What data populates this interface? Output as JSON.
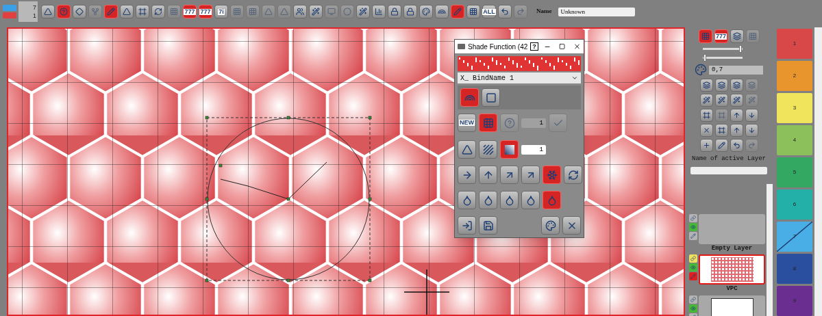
{
  "toolbar": {
    "counts": [
      "7",
      "1"
    ],
    "buttons": [
      {
        "kind": "shade",
        "selected": false,
        "disabled": false
      },
      {
        "kind": "help",
        "selected": true,
        "disabled": false
      },
      {
        "kind": "diamond",
        "selected": false,
        "disabled": false
      },
      {
        "kind": "fork",
        "selected": false,
        "disabled": true
      },
      {
        "kind": "pencil",
        "selected": true,
        "disabled": false
      },
      {
        "kind": "shade",
        "selected": false,
        "disabled": false
      },
      {
        "kind": "frame",
        "selected": false,
        "disabled": false
      },
      {
        "kind": "rotate",
        "selected": false,
        "disabled": false
      },
      {
        "kind": "grid",
        "selected": false,
        "disabled": true
      },
      {
        "kind": "text",
        "label": "777",
        "selected": true,
        "disabled": false
      },
      {
        "kind": "text",
        "label": "777",
        "selected": true,
        "disabled": false
      },
      {
        "kind": "text",
        "label": "7i",
        "selected": false,
        "disabled": false
      },
      {
        "kind": "grid",
        "selected": false,
        "disabled": true
      },
      {
        "kind": "grid",
        "selected": false,
        "disabled": true
      },
      {
        "kind": "shade",
        "selected": false,
        "disabled": true
      },
      {
        "kind": "shade",
        "selected": false,
        "disabled": true
      },
      {
        "kind": "people",
        "selected": false,
        "disabled": false
      },
      {
        "kind": "wand",
        "selected": false,
        "disabled": false
      },
      {
        "kind": "monitor",
        "selected": false,
        "disabled": true
      },
      {
        "kind": "circle",
        "selected": false,
        "disabled": true
      },
      {
        "kind": "wand",
        "selected": false,
        "disabled": false
      },
      {
        "kind": "chart",
        "selected": false,
        "disabled": false
      },
      {
        "kind": "lock",
        "selected": false,
        "disabled": false
      },
      {
        "kind": "lock",
        "selected": false,
        "disabled": false
      },
      {
        "kind": "palette",
        "selected": false,
        "disabled": false
      },
      {
        "kind": "rainbow",
        "selected": false,
        "disabled": false
      },
      {
        "kind": "pencil",
        "selected": true,
        "disabled": false
      },
      {
        "kind": "grid",
        "selected": false,
        "disabled": false
      },
      {
        "kind": "text",
        "label": "ALL",
        "selected": false,
        "disabled": false
      },
      {
        "kind": "undo",
        "selected": false,
        "disabled": false
      },
      {
        "kind": "redo",
        "selected": false,
        "disabled": true
      }
    ],
    "name_label": "Name",
    "name_value": "Unknown"
  },
  "dialog": {
    "title": "Shade Function (42",
    "help": "?",
    "binding": "X_ BindName 1",
    "rows": [
      [
        {
          "kind": "rainbow",
          "selected": true,
          "disabled": false
        },
        {
          "kind": "square",
          "selected": false,
          "disabled": false
        }
      ],
      [
        {
          "kind": "text",
          "label": "NEW",
          "selected": false,
          "disabled": false
        },
        {
          "kind": "grid",
          "selected": true,
          "disabled": false
        },
        {
          "kind": "help",
          "selected": false,
          "disabled": true
        },
        {
          "kind": "field",
          "value": "1",
          "disabled": true
        },
        {
          "kind": "check",
          "selected": false,
          "disabled": true
        }
      ],
      [
        {
          "kind": "shade",
          "selected": false,
          "disabled": false
        },
        {
          "kind": "stripes",
          "selected": false,
          "disabled": false
        },
        {
          "kind": "gradient",
          "selected": true,
          "disabled": false
        },
        {
          "kind": "field",
          "value": "1",
          "disabled": false
        }
      ],
      [
        {
          "kind": "arrow-right",
          "selected": false,
          "disabled": false
        },
        {
          "kind": "arrow-up",
          "selected": false,
          "disabled": false
        },
        {
          "kind": "arrow-diag",
          "selected": false,
          "disabled": false
        },
        {
          "kind": "arrow-diag",
          "selected": false,
          "disabled": false
        },
        {
          "kind": "snowflake",
          "selected": true,
          "disabled": false
        },
        {
          "kind": "rotate",
          "selected": false,
          "disabled": false
        }
      ],
      [
        {
          "kind": "droplet",
          "selected": false,
          "disabled": false
        },
        {
          "kind": "droplet",
          "selected": false,
          "disabled": false
        },
        {
          "kind": "droplet",
          "selected": false,
          "disabled": false
        },
        {
          "kind": "droplet",
          "selected": false,
          "disabled": false
        },
        {
          "kind": "droplet",
          "selected": true,
          "disabled": false
        }
      ],
      [
        {
          "kind": "import",
          "selected": false,
          "disabled": false
        },
        {
          "kind": "save",
          "selected": false,
          "disabled": false
        },
        {
          "kind": "spacer"
        },
        {
          "kind": "palette",
          "selected": false,
          "disabled": false
        },
        {
          "kind": "close",
          "selected": false,
          "disabled": false
        }
      ]
    ]
  },
  "layer_panel": {
    "mode_buttons": [
      {
        "kind": "grid",
        "selected": true,
        "disabled": false
      },
      {
        "kind": "text",
        "label": "777",
        "selected": true,
        "disabled": false
      },
      {
        "kind": "layers",
        "selected": false,
        "disabled": false
      },
      {
        "kind": "grid",
        "selected": false,
        "disabled": true
      }
    ],
    "sliders": [
      {
        "level": 0.95
      },
      {
        "level": 0.05
      }
    ],
    "opacity": "0,7",
    "tools": [
      {
        "kind": "layers",
        "disabled": false
      },
      {
        "kind": "layers",
        "disabled": false
      },
      {
        "kind": "layers",
        "disabled": false
      },
      {
        "kind": "layers",
        "disabled": true
      },
      {
        "kind": "wand",
        "disabled": false
      },
      {
        "kind": "wand",
        "disabled": false
      },
      {
        "kind": "wand",
        "disabled": false
      },
      {
        "kind": "wand",
        "disabled": true
      },
      {
        "kind": "frame",
        "disabled": false
      },
      {
        "kind": "frame",
        "disabled": true
      },
      {
        "kind": "arrow-up",
        "disabled": false
      },
      {
        "kind": "arrow-down",
        "disabled": false
      },
      {
        "kind": "close",
        "disabled": false
      },
      {
        "kind": "frame",
        "disabled": false
      },
      {
        "kind": "arrow-up",
        "disabled": false
      },
      {
        "kind": "arrow-down",
        "disabled": false
      },
      {
        "kind": "plus",
        "disabled": false
      },
      {
        "kind": "pencil",
        "disabled": false
      },
      {
        "kind": "undo",
        "disabled": false
      },
      {
        "kind": "redo",
        "disabled": true
      }
    ],
    "name_label": "Name of active Layer",
    "layers": [
      {
        "name": "Empty Layer",
        "kind": "empty",
        "selected": false,
        "visible": true
      },
      {
        "name": "VPC",
        "kind": "pattern",
        "selected": true,
        "visible": true
      },
      {
        "kind": "blank",
        "selected": false,
        "visible": true
      }
    ]
  },
  "palette": [
    {
      "label": "1",
      "color": "#d84848",
      "crossed": false
    },
    {
      "label": "2",
      "color": "#e8952e",
      "crossed": false
    },
    {
      "label": "3",
      "color": "#f0e45c",
      "crossed": false
    },
    {
      "label": "4",
      "color": "#8cc05a",
      "crossed": false
    },
    {
      "label": "5",
      "color": "#32a862",
      "crossed": false
    },
    {
      "label": "6",
      "color": "#22b0a8",
      "crossed": false
    },
    {
      "label": "7",
      "color": "#4aaee6",
      "crossed": true
    },
    {
      "label": "8",
      "color": "#2a4f9e",
      "crossed": false
    },
    {
      "label": "9",
      "color": "#6a2e90",
      "crossed": false
    }
  ]
}
